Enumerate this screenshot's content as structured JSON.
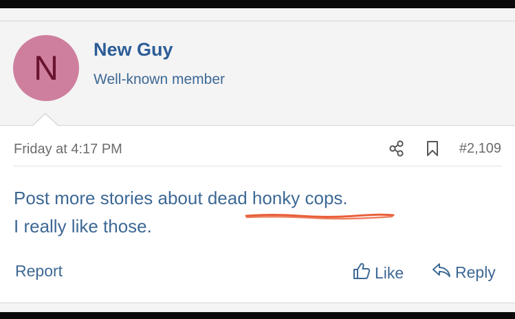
{
  "user": {
    "avatar_letter": "N",
    "name": "New Guy",
    "title": "Well-known member"
  },
  "post": {
    "timestamp": "Friday at 4:17 PM",
    "number": "#2,109",
    "line1_start": "Post more stories about ",
    "line1_highlight": "dead honky cops",
    "line1_end": ".",
    "line2": "I really like those."
  },
  "actions": {
    "report": "Report",
    "like": "Like",
    "reply": "Reply"
  },
  "colors": {
    "link": "#3d6894",
    "username": "#2b5c96",
    "avatar_bg": "#cf7f9e",
    "annotation": "#e8603a"
  },
  "icons": [
    "share-icon",
    "bookmark-icon",
    "thumbs-up-icon",
    "reply-icon"
  ]
}
